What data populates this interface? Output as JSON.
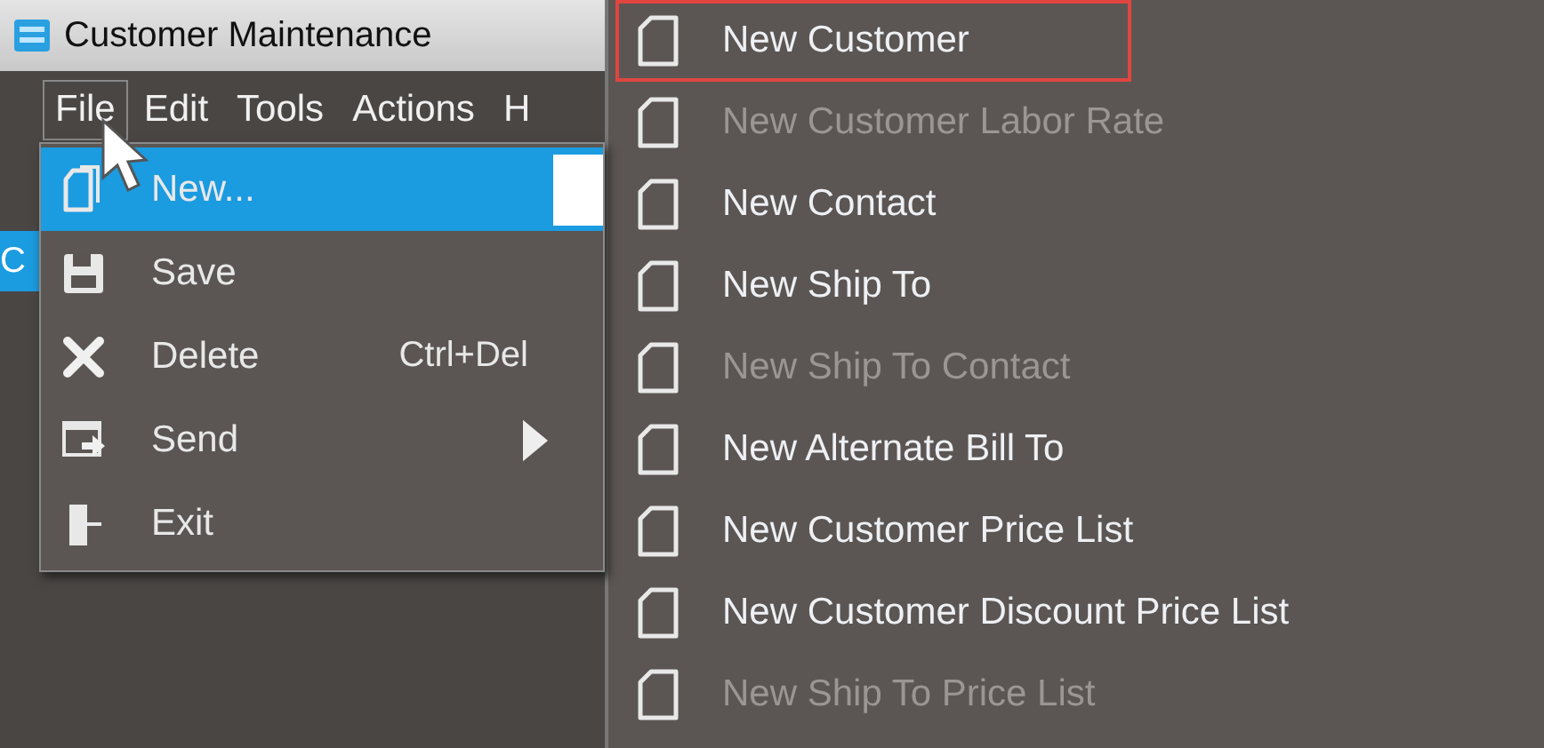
{
  "window": {
    "title": "Customer Maintenance"
  },
  "menubar": [
    {
      "label": "File",
      "selected": true
    },
    {
      "label": "Edit",
      "selected": false
    },
    {
      "label": "Tools",
      "selected": false
    },
    {
      "label": "Actions",
      "selected": false
    },
    {
      "label": "H",
      "selected": false
    }
  ],
  "side_tab": {
    "label": "C"
  },
  "file_menu": [
    {
      "label": "New...",
      "kind": "new",
      "selected": true,
      "submenu": false
    },
    {
      "label": "Save",
      "kind": "save",
      "selected": false,
      "submenu": false
    },
    {
      "label": "Delete",
      "kind": "delete",
      "shortcut": "Ctrl+Del",
      "selected": false,
      "submenu": false
    },
    {
      "label": "Send",
      "kind": "send",
      "selected": false,
      "submenu": true
    },
    {
      "label": "Exit",
      "kind": "exit",
      "selected": false,
      "submenu": false
    }
  ],
  "new_submenu": [
    {
      "label": "New Customer",
      "disabled": false,
      "outlined": true
    },
    {
      "label": "New Customer Labor Rate",
      "disabled": true,
      "outlined": false
    },
    {
      "label": "New Contact",
      "disabled": false,
      "outlined": false
    },
    {
      "label": "New Ship To",
      "disabled": false,
      "outlined": false
    },
    {
      "label": "New Ship To Contact",
      "disabled": true,
      "outlined": false
    },
    {
      "label": "New Alternate Bill To",
      "disabled": false,
      "outlined": false
    },
    {
      "label": "New Customer Price List",
      "disabled": false,
      "outlined": false
    },
    {
      "label": "New Customer Discount Price List",
      "disabled": false,
      "outlined": false
    },
    {
      "label": "New Ship To Price List",
      "disabled": true,
      "outlined": false
    }
  ]
}
